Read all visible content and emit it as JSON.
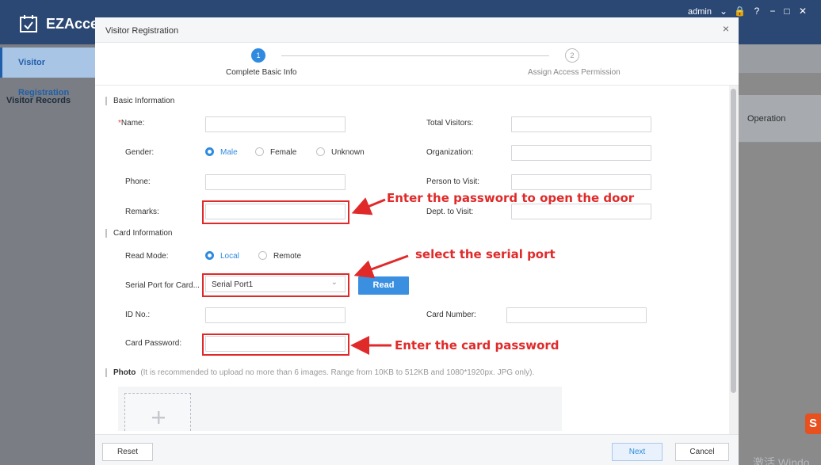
{
  "app": {
    "title": "EZAcce",
    "user": "admin",
    "sidebar": [
      "Visitor Registration",
      "Visitor Records"
    ],
    "table_header_operation": "Operation",
    "watermark": "激活 Windo"
  },
  "modal": {
    "title": "Visitor Registration",
    "close_icon": "×",
    "steps": [
      {
        "number": "1",
        "label": "Complete Basic Info"
      },
      {
        "number": "2",
        "label": "Assign Access Permission"
      }
    ],
    "basic_section": "Basic Information",
    "fields": {
      "name_req": "*",
      "name": "Name:",
      "gender": "Gender:",
      "phone": "Phone:",
      "remarks": "Remarks:",
      "total_visitors": "Total Visitors:",
      "organization": "Organization:",
      "person_to_visit": "Person to Visit:",
      "dept_to_visit": "Dept. to Visit:"
    },
    "gender_options": [
      "Male",
      "Female",
      "Unknown"
    ],
    "card_section": "Card Information",
    "card_fields": {
      "read_mode": "Read Mode:",
      "serial_port": "Serial Port for Card...",
      "id_no": "ID No.:",
      "card_number": "Card Number:",
      "card_password": "Card Password:"
    },
    "read_mode_options": [
      "Local",
      "Remote"
    ],
    "serial_port_value": "Serial Port1",
    "read_button": "Read",
    "photo_label": "Photo",
    "photo_hint": "(It is recommended to upload no more than 6 images. Range from 10KB to 512KB and 1080*1920px. JPG only).",
    "footer": {
      "reset": "Reset",
      "next": "Next",
      "cancel": "Cancel"
    }
  },
  "annotations": {
    "remarks": "Enter the password to open the door",
    "serial": "select the serial port",
    "card_password": "Enter the card password"
  },
  "colors": {
    "accent": "#2f8ae0",
    "annotation": "#e02a2a",
    "header": "#2b4773"
  }
}
